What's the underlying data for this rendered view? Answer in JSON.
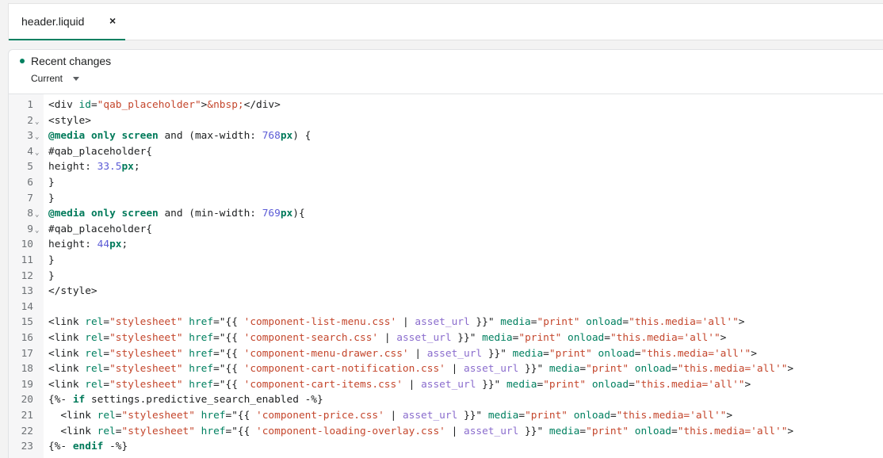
{
  "tabs": [
    {
      "label": "header.liquid",
      "close": "×"
    }
  ],
  "recent_changes": {
    "title": "Recent changes",
    "version": "Current"
  },
  "code_lines": [
    {
      "n": "1",
      "fold": false,
      "tokens": [
        [
          "t",
          "<div "
        ],
        [
          "attr",
          "id"
        ],
        [
          "t",
          "="
        ],
        [
          "str",
          "\"qab_placeholder\""
        ],
        [
          "t",
          ">"
        ],
        [
          "str",
          "&nbsp;"
        ],
        [
          "t",
          "</div>"
        ]
      ]
    },
    {
      "n": "2",
      "fold": true,
      "tokens": [
        [
          "t",
          "<style>"
        ]
      ]
    },
    {
      "n": "3",
      "fold": true,
      "tokens": [
        [
          "kw",
          "@media"
        ],
        [
          "t",
          " "
        ],
        [
          "kw",
          "only"
        ],
        [
          "t",
          " "
        ],
        [
          "kw",
          "screen"
        ],
        [
          "t",
          " and (max-width: "
        ],
        [
          "num",
          "768"
        ],
        [
          "kw",
          "px"
        ],
        [
          "t",
          ") {"
        ]
      ]
    },
    {
      "n": "4",
      "fold": true,
      "tokens": [
        [
          "t",
          "#qab_placeholder{"
        ]
      ]
    },
    {
      "n": "5",
      "fold": false,
      "tokens": [
        [
          "t",
          "height: "
        ],
        [
          "num",
          "33.5"
        ],
        [
          "kw",
          "px"
        ],
        [
          "t",
          ";"
        ]
      ]
    },
    {
      "n": "6",
      "fold": false,
      "tokens": [
        [
          "t",
          "}"
        ]
      ]
    },
    {
      "n": "7",
      "fold": false,
      "tokens": [
        [
          "t",
          "}"
        ]
      ]
    },
    {
      "n": "8",
      "fold": true,
      "tokens": [
        [
          "kw",
          "@media"
        ],
        [
          "t",
          " "
        ],
        [
          "kw",
          "only"
        ],
        [
          "t",
          " "
        ],
        [
          "kw",
          "screen"
        ],
        [
          "t",
          " and (min-width: "
        ],
        [
          "num",
          "769"
        ],
        [
          "kw",
          "px"
        ],
        [
          "t",
          "){"
        ]
      ]
    },
    {
      "n": "9",
      "fold": true,
      "tokens": [
        [
          "t",
          "#qab_placeholder{"
        ]
      ]
    },
    {
      "n": "10",
      "fold": false,
      "tokens": [
        [
          "t",
          "height: "
        ],
        [
          "num",
          "44"
        ],
        [
          "kw",
          "px"
        ],
        [
          "t",
          ";"
        ]
      ]
    },
    {
      "n": "11",
      "fold": false,
      "tokens": [
        [
          "t",
          "}"
        ]
      ]
    },
    {
      "n": "12",
      "fold": false,
      "tokens": [
        [
          "t",
          "}"
        ]
      ]
    },
    {
      "n": "13",
      "fold": false,
      "tokens": [
        [
          "t",
          "</style>"
        ]
      ]
    },
    {
      "n": "14",
      "fold": false,
      "tokens": []
    },
    {
      "n": "15",
      "fold": false,
      "tokens": [
        [
          "t",
          "<link "
        ],
        [
          "attr",
          "rel"
        ],
        [
          "t",
          "="
        ],
        [
          "str",
          "\"stylesheet\""
        ],
        [
          "t",
          " "
        ],
        [
          "attr",
          "href"
        ],
        [
          "t",
          "=\"{{ "
        ],
        [
          "str",
          "'component-list-menu.css'"
        ],
        [
          "t",
          " | "
        ],
        [
          "filter",
          "asset_url"
        ],
        [
          "t",
          " }}\" "
        ],
        [
          "attr",
          "media"
        ],
        [
          "t",
          "="
        ],
        [
          "str",
          "\"print\""
        ],
        [
          "t",
          " "
        ],
        [
          "attr",
          "onload"
        ],
        [
          "t",
          "="
        ],
        [
          "str",
          "\"this.media='all'\""
        ],
        [
          "t",
          ">"
        ]
      ]
    },
    {
      "n": "16",
      "fold": false,
      "tokens": [
        [
          "t",
          "<link "
        ],
        [
          "attr",
          "rel"
        ],
        [
          "t",
          "="
        ],
        [
          "str",
          "\"stylesheet\""
        ],
        [
          "t",
          " "
        ],
        [
          "attr",
          "href"
        ],
        [
          "t",
          "=\"{{ "
        ],
        [
          "str",
          "'component-search.css'"
        ],
        [
          "t",
          " | "
        ],
        [
          "filter",
          "asset_url"
        ],
        [
          "t",
          " }}\" "
        ],
        [
          "attr",
          "media"
        ],
        [
          "t",
          "="
        ],
        [
          "str",
          "\"print\""
        ],
        [
          "t",
          " "
        ],
        [
          "attr",
          "onload"
        ],
        [
          "t",
          "="
        ],
        [
          "str",
          "\"this.media='all'\""
        ],
        [
          "t",
          ">"
        ]
      ]
    },
    {
      "n": "17",
      "fold": false,
      "tokens": [
        [
          "t",
          "<link "
        ],
        [
          "attr",
          "rel"
        ],
        [
          "t",
          "="
        ],
        [
          "str",
          "\"stylesheet\""
        ],
        [
          "t",
          " "
        ],
        [
          "attr",
          "href"
        ],
        [
          "t",
          "=\"{{ "
        ],
        [
          "str",
          "'component-menu-drawer.css'"
        ],
        [
          "t",
          " | "
        ],
        [
          "filter",
          "asset_url"
        ],
        [
          "t",
          " }}\" "
        ],
        [
          "attr",
          "media"
        ],
        [
          "t",
          "="
        ],
        [
          "str",
          "\"print\""
        ],
        [
          "t",
          " "
        ],
        [
          "attr",
          "onload"
        ],
        [
          "t",
          "="
        ],
        [
          "str",
          "\"this.media='all'\""
        ],
        [
          "t",
          ">"
        ]
      ]
    },
    {
      "n": "18",
      "fold": false,
      "tokens": [
        [
          "t",
          "<link "
        ],
        [
          "attr",
          "rel"
        ],
        [
          "t",
          "="
        ],
        [
          "str",
          "\"stylesheet\""
        ],
        [
          "t",
          " "
        ],
        [
          "attr",
          "href"
        ],
        [
          "t",
          "=\"{{ "
        ],
        [
          "str",
          "'component-cart-notification.css'"
        ],
        [
          "t",
          " | "
        ],
        [
          "filter",
          "asset_url"
        ],
        [
          "t",
          " }}\" "
        ],
        [
          "attr",
          "media"
        ],
        [
          "t",
          "="
        ],
        [
          "str",
          "\"print\""
        ],
        [
          "t",
          " "
        ],
        [
          "attr",
          "onload"
        ],
        [
          "t",
          "="
        ],
        [
          "str",
          "\"this.media='all'\""
        ],
        [
          "t",
          ">"
        ]
      ]
    },
    {
      "n": "19",
      "fold": false,
      "tokens": [
        [
          "t",
          "<link "
        ],
        [
          "attr",
          "rel"
        ],
        [
          "t",
          "="
        ],
        [
          "str",
          "\"stylesheet\""
        ],
        [
          "t",
          " "
        ],
        [
          "attr",
          "href"
        ],
        [
          "t",
          "=\"{{ "
        ],
        [
          "str",
          "'component-cart-items.css'"
        ],
        [
          "t",
          " | "
        ],
        [
          "filter",
          "asset_url"
        ],
        [
          "t",
          " }}\" "
        ],
        [
          "attr",
          "media"
        ],
        [
          "t",
          "="
        ],
        [
          "str",
          "\"print\""
        ],
        [
          "t",
          " "
        ],
        [
          "attr",
          "onload"
        ],
        [
          "t",
          "="
        ],
        [
          "str",
          "\"this.media='all'\""
        ],
        [
          "t",
          ">"
        ]
      ]
    },
    {
      "n": "20",
      "fold": false,
      "tokens": [
        [
          "t",
          "{%- "
        ],
        [
          "kw",
          "if"
        ],
        [
          "t",
          " settings.predictive_search_enabled -%}"
        ]
      ]
    },
    {
      "n": "21",
      "fold": false,
      "tokens": [
        [
          "t",
          "  <link "
        ],
        [
          "attr",
          "rel"
        ],
        [
          "t",
          "="
        ],
        [
          "str",
          "\"stylesheet\""
        ],
        [
          "t",
          " "
        ],
        [
          "attr",
          "href"
        ],
        [
          "t",
          "=\"{{ "
        ],
        [
          "str",
          "'component-price.css'"
        ],
        [
          "t",
          " | "
        ],
        [
          "filter",
          "asset_url"
        ],
        [
          "t",
          " }}\" "
        ],
        [
          "attr",
          "media"
        ],
        [
          "t",
          "="
        ],
        [
          "str",
          "\"print\""
        ],
        [
          "t",
          " "
        ],
        [
          "attr",
          "onload"
        ],
        [
          "t",
          "="
        ],
        [
          "str",
          "\"this.media='all'\""
        ],
        [
          "t",
          ">"
        ]
      ]
    },
    {
      "n": "22",
      "fold": false,
      "tokens": [
        [
          "t",
          "  <link "
        ],
        [
          "attr",
          "rel"
        ],
        [
          "t",
          "="
        ],
        [
          "str",
          "\"stylesheet\""
        ],
        [
          "t",
          " "
        ],
        [
          "attr",
          "href"
        ],
        [
          "t",
          "=\"{{ "
        ],
        [
          "str",
          "'component-loading-overlay.css'"
        ],
        [
          "t",
          " | "
        ],
        [
          "filter",
          "asset_url"
        ],
        [
          "t",
          " }}\" "
        ],
        [
          "attr",
          "media"
        ],
        [
          "t",
          "="
        ],
        [
          "str",
          "\"print\""
        ],
        [
          "t",
          " "
        ],
        [
          "attr",
          "onload"
        ],
        [
          "t",
          "="
        ],
        [
          "str",
          "\"this.media='all'\""
        ],
        [
          "t",
          ">"
        ]
      ]
    },
    {
      "n": "23",
      "fold": false,
      "tokens": [
        [
          "t",
          "{%- "
        ],
        [
          "kw",
          "endif"
        ],
        [
          "t",
          " -%}"
        ]
      ]
    }
  ],
  "colors": {
    "accent": "#008060",
    "string": "#c4462c",
    "number": "#5b5bd6",
    "filter": "#8a6ccd",
    "keyword": "#007a5a"
  }
}
